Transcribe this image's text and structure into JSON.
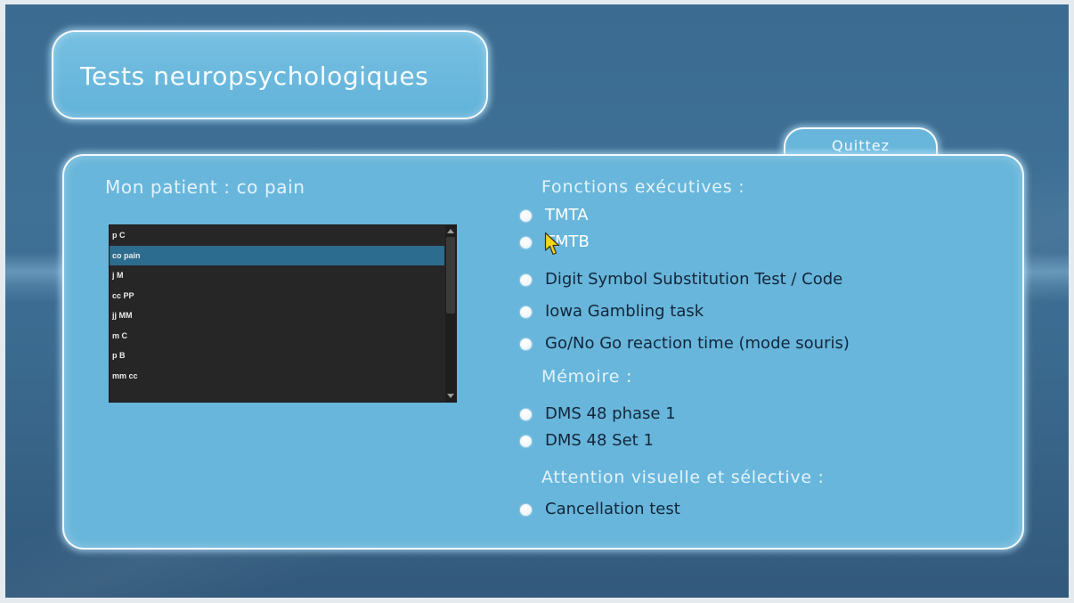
{
  "app": {
    "title": "Tests neuropsychologiques",
    "quit_button": "Quittez"
  },
  "patient": {
    "label": "Mon patient :",
    "current": "co pain",
    "list": [
      "p C",
      "co pain",
      "j M",
      "cc PP",
      "jj MM",
      "m C",
      "p B",
      "mm cc"
    ],
    "selected_index": 1
  },
  "sections": {
    "executive": {
      "heading": "Fonctions exécutives :",
      "items": [
        {
          "label": "TMTA",
          "color": "#ffffff"
        },
        {
          "label": "TMTB",
          "color": "#ffffff"
        },
        {
          "label": "Digit Symbol Substitution Test / Code",
          "color": "#13263a"
        },
        {
          "label": "Iowa Gambling task",
          "color": "#13263a"
        },
        {
          "label": "Go/No Go reaction time (mode souris)",
          "color": "#13263a"
        }
      ]
    },
    "memory": {
      "heading": "Mémoire :",
      "items": [
        {
          "label": "DMS 48 phase 1",
          "color": "#13263a"
        },
        {
          "label": "DMS 48 Set 1",
          "color": "#13263a"
        }
      ]
    },
    "attention": {
      "heading": "Attention visuelle et sélective :",
      "items": [
        {
          "label": "Cancellation test",
          "color": "#13263a"
        }
      ]
    }
  },
  "colors": {
    "background": "#3b6b90",
    "panel": "#68b6db",
    "panel_border": "#ffffff",
    "heading_text": "#e3f3fb",
    "listbox_bg": "#262626",
    "listbox_selected": "#2c6c8e",
    "radio_bullet": "#ffffff",
    "cursor": "#f2d61a"
  },
  "icons": {
    "radio": "radio-bullet-icon",
    "scroll_up": "scroll-up-arrow-icon",
    "scroll_down": "scroll-down-arrow-icon",
    "cursor": "mouse-cursor-icon"
  }
}
